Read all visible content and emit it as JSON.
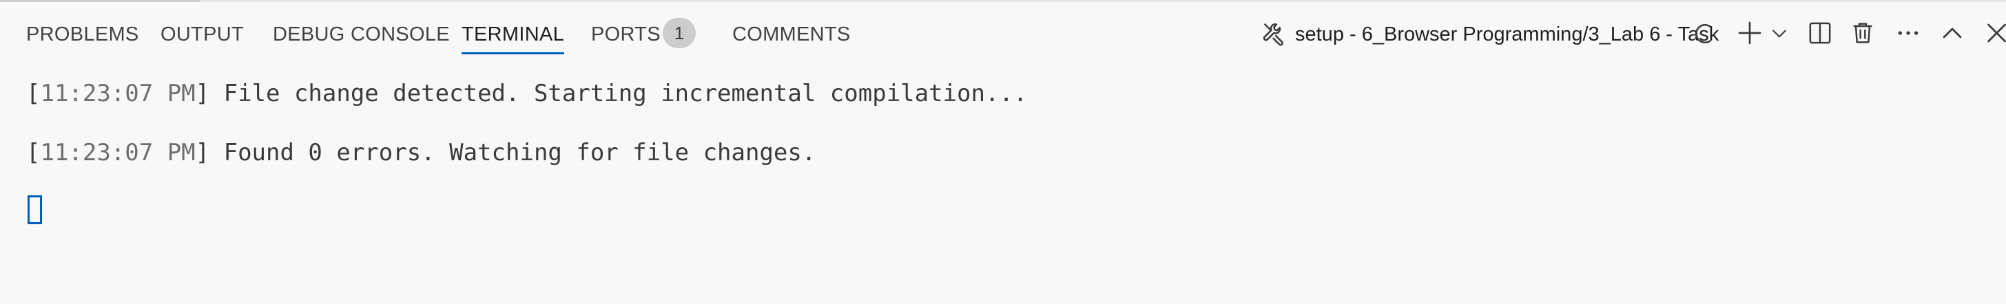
{
  "tabs": [
    {
      "label": "PROBLEMS"
    },
    {
      "label": "OUTPUT"
    },
    {
      "label": "DEBUG CONSOLE"
    },
    {
      "label": "TERMINAL",
      "active": true
    },
    {
      "label": "PORTS",
      "badge": "1"
    },
    {
      "label": "COMMENTS"
    }
  ],
  "task": {
    "title": "setup - 6_Browser Programming/3_Lab 6 - Task",
    "icon": "tools-icon",
    "status_icon": "loading-spinner-icon"
  },
  "actions": [
    {
      "name": "new-terminal",
      "icon": "plus-icon"
    },
    {
      "name": "terminal-dropdown",
      "icon": "chevron-down-icon"
    },
    {
      "name": "split-terminal",
      "icon": "split-icon"
    },
    {
      "name": "kill-terminal",
      "icon": "trash-icon"
    },
    {
      "name": "more-actions",
      "icon": "ellipsis-icon"
    },
    {
      "name": "maximize-panel",
      "icon": "chevron-up-icon"
    },
    {
      "name": "close-panel",
      "icon": "close-icon"
    }
  ],
  "terminal": {
    "lines": [
      {
        "open": "[",
        "time": "11:23:07 PM",
        "close": "]",
        "message": " File change detected. Starting incremental compilation..."
      },
      {
        "open": "[",
        "time": "11:23:07 PM",
        "close": "]",
        "message": " Found 0 errors. Watching for file changes."
      }
    ]
  },
  "colors": {
    "background": "#f8f8f8",
    "accent": "#005fb8",
    "badge": "#cccccc",
    "text": "#3b3b3b"
  }
}
